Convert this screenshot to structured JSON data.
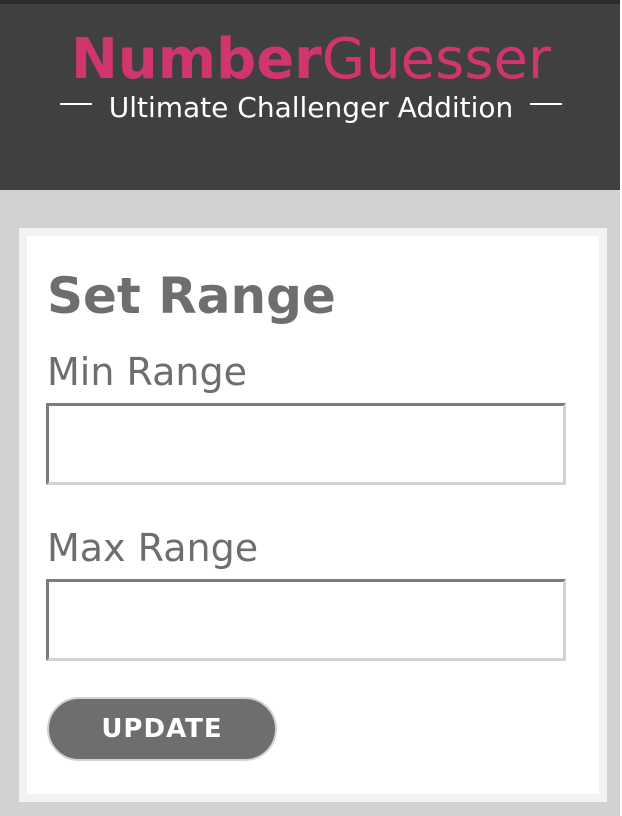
{
  "header": {
    "logo_bold": "Number",
    "logo_light": "Guesser",
    "tagline": "Ultimate Challenger Addition"
  },
  "range_form": {
    "title": "Set Range",
    "min_label": "Min Range",
    "min_value": "",
    "max_label": "Max Range",
    "max_value": "",
    "update_label": "UPDATE"
  },
  "colors": {
    "brand_pink": "#d1356e",
    "header_bg": "#404041",
    "page_bg": "#d1d2d4",
    "text_gray": "#6d6e70"
  }
}
